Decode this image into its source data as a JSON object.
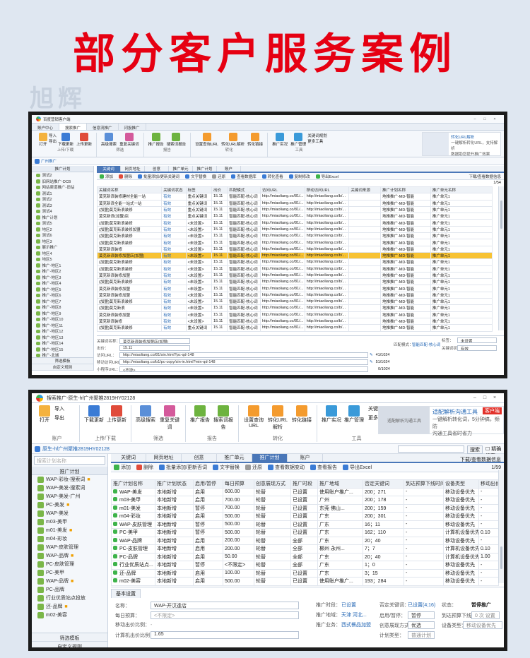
{
  "header": {
    "title": "部分客户服务案例",
    "watermark": "旭辉"
  },
  "w1": {
    "title": "百度营销客户端",
    "menu": [
      "账户中心",
      "搜索推广",
      "信息流推广",
      "闪投推广"
    ],
    "ribbon": {
      "open": "打开",
      "import": "导入",
      "export": "导出",
      "download_updates": "下载更新",
      "upload_updates": "上传更新",
      "upload_group": "上传/下载",
      "advanced_search": "高级搜索",
      "keyword_dedup": "重复关键词",
      "filter_group": "筛选",
      "promo_report": "推广报告",
      "search_report": "搜索词报告",
      "set_queries": "设置查询URL",
      "convert_url": "转化URL解析",
      "convert_link": "转化链接",
      "promo_realtime": "推广实况",
      "promo_manage": "推广管理",
      "keyword_planner": "关键词规划",
      "more_tools": "更多工具",
      "report_group": "报告",
      "convert_group": "转化",
      "tools_group": "工具",
      "ad_title": "转化URL解析",
      "ad_sub1": "一键解析转化URL，支持解析",
      "ad_sub2": "数据助您提升推广效果"
    },
    "account": "广州推广",
    "tabs": [
      "关键词",
      "网页地址",
      "创意",
      "推广单元",
      "推广计划",
      "账户"
    ],
    "toolbar": [
      "添加",
      "删除",
      "批量添加/更新关键词",
      "文字替换",
      "还原",
      "查看数据库",
      "转化查看",
      "复制修改",
      "导出Excel"
    ],
    "toolbar_right": "下载/查看数据信息",
    "page": "1/54",
    "sidebar_head": "推广计划",
    "sidebar_items": [
      "测试2",
      "旧网站推广-DCB",
      "网站渠道推广-旧站",
      "测试1",
      "测试2",
      "测试3",
      "测试4",
      "推广计划",
      "测试5",
      "地区2",
      "测试6",
      "地区3",
      "展示推广",
      "地区4",
      "地区5",
      "推广-地区1",
      "推广-地区2",
      "推广-地区3",
      "推广-地区4",
      "推广-地区5",
      "推广-地区6",
      "推广-地区7",
      "推广-地区8",
      "推广-地区9",
      "推广-地区10",
      "推广-地区11",
      "推广-地区12",
      "推广-地区13",
      "推广-地区14",
      "推广-地区15",
      "推广-北城",
      "推广-北城2"
    ],
    "sidebar_foot": [
      "筛选模板",
      "自定义规则"
    ],
    "columns": [
      "关键词名称",
      "关键词状态",
      "标签",
      "出价",
      "匹配模式",
      "访问URL",
      "移动访问URL",
      "关键词来源",
      "推广计划名称",
      "推广单元名称"
    ],
    "rows": [
      [
        "莫克新浪装修建材全能一站",
        "有效",
        "重点关键词",
        "15.11",
        "智能匹配-核心词",
        "http://miaoliang.co/81/...",
        "http://miaoliang.co/b/...",
        "",
        "地推推广-MD-智能",
        "推广单元1"
      ],
      [
        "莫克新浪全能一站式一站",
        "有效",
        "重点关键词",
        "15.11",
        "智能匹配-核心词",
        "http://miaoliang.co/81/...",
        "http://miaoliang.co/b/...",
        "",
        "地推推广-MD-智能",
        "推广单元1"
      ],
      [
        "(加盟)莫克新浪装修",
        "有效",
        "重点关键词",
        "15.11",
        "智能匹配-核心词",
        "http://miaoliang.co/81/...",
        "http://miaoliang.co/b/...",
        "",
        "地推推广-MD-智能",
        "推广单元1"
      ],
      [
        "莫克新浪(加盟)店",
        "有效",
        "重点关键词",
        "15.11",
        "智能匹配-核心词",
        "http://miaoliang.co/81/...",
        "http://miaoliang.co/b/...",
        "",
        "地推推广-MD-智能",
        "推广单元1"
      ],
      [
        "(加盟)莫克新浪装修",
        "有效",
        "<未设置>",
        "15.11",
        "智能匹配-核心词",
        "http://miaoliang.co/81/...",
        "http://miaoliang.co/b/...",
        "",
        "地推推广-MD-智能",
        "推广单元1"
      ],
      [
        "(加盟)莫克新浪装修加盟",
        "有效",
        "<未设置>",
        "15.11",
        "智能匹配-核心词",
        "http://miaoliang.co/81/...",
        "http://miaoliang.co/b/...",
        "",
        "地推推广-MD-智能",
        "推广单元1"
      ],
      [
        "(加盟)莫克新浪装修",
        "有效",
        "<未设置>",
        "15.11",
        "智能匹配-核心词",
        "http://miaoliang.co/81/...",
        "http://miaoliang.co/b/...",
        "",
        "地推推广-MD-智能",
        "推广单元1"
      ],
      [
        "(加盟)莫克新浪装修",
        "有效",
        "<未设置>",
        "15.11",
        "智能匹配-核心词",
        "http://miaoliang.co/81/...",
        "http://miaoliang.co/b/...",
        "",
        "地推推广-MD-智能",
        "推广单元1"
      ],
      [
        "莫克新浪装修",
        "有效",
        "<未设置>",
        "15.11",
        "智能匹配-核心词",
        "http://miaoliang.co/81/...",
        "http://miaoliang.co/b/...",
        "",
        "地推推广-MD-智能",
        "推广单元1"
      ],
      [
        "莫克新浪装修加盟店(加盟)",
        "有效",
        "<未设置>",
        "15.11",
        "智能匹配-核心词",
        "http://miaoliang.co/81/...",
        "http://miaoliang.co/b/...",
        "",
        "地推推广-MD-智能",
        "推广单元1"
      ],
      [
        "(加盟)莫克新浪装修",
        "有效",
        "<未设置>",
        "15.11",
        "智能匹配-核心词",
        "http://miaoliang.co/81/...",
        "http://miaoliang.co/b/...",
        "",
        "地推推广-MD-智能",
        "推广单元1"
      ],
      [
        "(加盟)莫克新浪装修",
        "有效",
        "<未设置>",
        "15.11",
        "智能匹配-核心词",
        "http://miaoliang.co/81/...",
        "http://miaoliang.co/b/...",
        "",
        "地推推广-MD-智能",
        "推广单元1"
      ],
      [
        "莫克新浪装修加盟",
        "有效",
        "<未设置>",
        "15.11",
        "智能匹配-核心词",
        "http://miaoliang.co/81/...",
        "http://miaoliang.co/b/...",
        "",
        "地推推广-MD-智能",
        "推广单元1"
      ],
      [
        "(加盟)莫克新浪装修",
        "有效",
        "<未设置>",
        "15.11",
        "智能匹配-核心词",
        "http://miaoliang.co/81/...",
        "http://miaoliang.co/b/...",
        "",
        "地推推广-MD-智能",
        "推广单元1"
      ],
      [
        "莫克新浪装修加盟",
        "有效",
        "<未设置>",
        "15.11",
        "智能匹配-核心词",
        "http://miaoliang.co/81/...",
        "http://miaoliang.co/b/...",
        "",
        "地推推广-MD-智能",
        "推广单元1"
      ],
      [
        "莫克新浪装修加盟",
        "有效",
        "<未设置>",
        "15.11",
        "智能匹配-核心词",
        "http://miaoliang.co/81/...",
        "http://miaoliang.co/b/...",
        "",
        "地推推广-MD-智能",
        "推广单元1"
      ],
      [
        "(加盟)莫克新浪装修",
        "有效",
        "<未设置>",
        "15.11",
        "智能匹配-核心词",
        "http://miaoliang.co/81/...",
        "http://miaoliang.co/b/...",
        "",
        "地推推广-MD-智能",
        "推广单元1"
      ],
      [
        "(加盟)莫克新浪",
        "有效",
        "<未设置>",
        "15.11",
        "智能匹配-核心词",
        "http://miaoliang.co/81/...",
        "http://miaoliang.co/b/...",
        "",
        "地推推广-MD-智能",
        "推广单元1"
      ],
      [
        "莫克新浪装修加盟",
        "有效",
        "<未设置>",
        "15.11",
        "智能匹配-核心词",
        "http://miaoliang.co/81/...",
        "http://miaoliang.co/b/...",
        "",
        "地推推广-MD-智能",
        "推广单元1"
      ],
      [
        "莫克新浪装修",
        "有效",
        "<未设置>",
        "15.11",
        "智能匹配-核心词",
        "http://miaoliang.co/81/...",
        "http://miaoliang.co/b/...",
        "",
        "地推推广-MD-智能",
        "推广单元1"
      ],
      [
        "(加盟)莫克新浪装修",
        "有效",
        "重点关键词",
        "15.11",
        "智能匹配-核心词",
        "http://miaoliang.co/81/...",
        "http://miaoliang.co/b/...",
        "",
        "地推推广-MD-智能",
        "推广单元1"
      ]
    ],
    "highlight_row": 9,
    "detail": {
      "kw_label": "关键词名称：",
      "kw_value": "莫克新浪装修加盟店(加盟)",
      "bid_label": "出价：",
      "bid_value": "15.11",
      "url_label": "访问URL：",
      "url_value": "http://miaoliang.co/81/sin.html?pc-qd-148",
      "murl_label": "移动访问URL：",
      "murl_value": "http://miaoliang.co/b1/pc-copy/sin-in.html?min-qd-148",
      "mon_label": "小程序URL：",
      "mon_value": "<不设>",
      "match_label": "匹配模式：",
      "match_value": "智能匹配-核心词",
      "tag_label": "标签：",
      "tag_value": "未设置",
      "status_label": "关键词状态：",
      "status_value": "有效",
      "count1": "41/1024",
      "count2": "51/1024",
      "count3": "0/1024"
    }
  },
  "w2": {
    "title": "搜索推广-原生-hf广州聚推2819HY02128",
    "ribbon": {
      "open": "打开",
      "import": "导入",
      "export": "导出",
      "download_updates": "下载更新",
      "upload_updates": "上传更新",
      "account_group": "账户",
      "upload_group": "上传/下载",
      "advanced_search": "高级搜索",
      "keyword_dedup": "重复关键词",
      "filter_group": "筛选",
      "promo_report": "推广报告",
      "search_report": "搜索词报告",
      "report_group": "报告",
      "set_queries": "设置查询URL",
      "convert_url": "转化URL解析",
      "convert_link": "转化链接",
      "convert_group": "转化",
      "promo_realtime": "推广实况",
      "promo_manage": "推广管理",
      "keyword_planner": "关键词规划",
      "more_tools": "更多工具",
      "tools_group": "工具",
      "ad_box": "适配解析沟通工具",
      "ad_title": "适配解析沟通工具",
      "ad_sub1": "一键解析转化词，5分钟搞，频防",
      "ad_sub2": "沟通工具省时省力",
      "ad_tag": "客户端"
    },
    "account": "原生-hf广州聚推2819HY02128",
    "search_btn": "搜索",
    "exact_search": "精确搜索",
    "tabs": [
      "关键词",
      "网页地址",
      "创意",
      "推广单元",
      "推广计划",
      "账户"
    ],
    "toolbar": [
      "添加",
      "删除",
      "批量添加/更新否词",
      "文字替换",
      "还原",
      "查看数据变动",
      "查看报告",
      "导出Excel"
    ],
    "toolbar_right": "下载/查看数据信息",
    "page": "1/59",
    "sidebar_search": "搜索计划名称",
    "sidebar_head": "推广计划",
    "sidebar_items": [
      "WAP-彩妆-搜索词",
      "WAP-美发-搜索词",
      "WAP-美发-广州",
      "PC-美发",
      "WAP-美发",
      "m03-美甲",
      "m01-美发",
      "m04-彩妆",
      "WAP-皮肤管理",
      "WAP-品牌",
      "PC-皮肤管理",
      "PC-美甲",
      "WAP-品牌",
      "PC-品牌",
      "行业优质站点投放",
      "还-品牌",
      "m02-美容"
    ],
    "sidebar_foot": [
      "筛选模板",
      "自定义规则"
    ],
    "columns": [
      "推广计划名称",
      "推广计划状态",
      "启用/暂停",
      "每日预算",
      "创意展现方式",
      "推广时段",
      "推广地域",
      "否定关键词",
      "到达预算下线时间",
      "设备类型",
      "移动出价"
    ],
    "rows": [
      [
        "WAP-美发",
        "本地新增",
        "启用",
        "600.00",
        "轮替",
        "已设置",
        "使用账户推广...",
        "200；271",
        "-",
        "移动设备优先",
        "-"
      ],
      [
        "m03-美甲",
        "本地新增",
        "启用",
        "700.00",
        "轮替",
        "已设置",
        "广州",
        "200；178",
        "-",
        "移动设备优先",
        "-"
      ],
      [
        "m01-美发",
        "本地新增",
        "暂停",
        "700.00",
        "轮替",
        "已设置",
        "东莞 佛山...",
        "200；159",
        "-",
        "移动设备优先",
        "-"
      ],
      [
        "m04-彩妆",
        "本地新增",
        "启用",
        "500.00",
        "轮替",
        "已设置",
        "广东",
        "200；301",
        "-",
        "移动设备优先",
        "-"
      ],
      [
        "WAP-皮肤管理",
        "本地新增",
        "暂停",
        "500.00",
        "轮替",
        "已设置",
        "广东",
        "16；11",
        "-",
        "移动设备优先",
        "-"
      ],
      [
        "PC-美甲",
        "本地新增",
        "暂停",
        "500.00",
        "轮替",
        "已设置",
        "广东",
        "162；110",
        "-",
        "计算机设备优先",
        "0.10"
      ],
      [
        "WAP-品牌",
        "本地新增",
        "启用",
        "200.00",
        "轮替",
        "全部",
        "广东",
        "20；40",
        "-",
        "移动设备优先",
        "-"
      ],
      [
        "PC-皮肤管理",
        "本地新增",
        "启用",
        "200.00",
        "轮替",
        "全部",
        "郴州 永州...",
        "7；7",
        "-",
        "计算机设备优先",
        "0.10"
      ],
      [
        "PC-品牌",
        "本地新增",
        "启用",
        "50.00",
        "轮替",
        "全部",
        "广东",
        "20；40",
        "-",
        "计算机设备优先",
        "1.00"
      ],
      [
        "行业优质站点...",
        "本地新增",
        "暂停",
        "<不限定>",
        "轮替",
        "全部",
        "广东",
        "1；0",
        "-",
        "移动设备优先",
        "-"
      ],
      [
        "还-品牌",
        "本地新增",
        "启用",
        "100.00",
        "轮替",
        "已设置",
        "广东",
        "3；15",
        "-",
        "移动设备优先",
        "-"
      ],
      [
        "m02-美容",
        "本地新增",
        "启用",
        "500.00",
        "轮替",
        "已设置",
        "使用账户推广...",
        "193；284",
        "-",
        "移动设备优先",
        "-"
      ]
    ],
    "detail": {
      "tab": "基本设置",
      "name_label": "名称：",
      "name_value": "WAP-开汉逢店",
      "budget_label": "每日预算：",
      "budget_value": "<不限定>",
      "ratio_label": "移动出价比例：",
      "ratio_value": "-",
      "pc_ratio_label": "计算机出价比例：",
      "pc_ratio_value": "1.65",
      "time_label": "推广时段：",
      "time_value": "已设置",
      "region_label": "推广地域：",
      "region_value": "天津 河北...",
      "biz_label": "推广业务：",
      "biz_value": "西式餐品加盟",
      "neg_label": "否定关键词：",
      "neg_value": "已设置(4;16)",
      "pause_label": "启用/暂停：",
      "pause_value": "暂停",
      "style_label": "创意展现方式：",
      "style_value": "优选",
      "type_label": "计划类型：",
      "type_value": "普通计划",
      "state_label": "状态：",
      "state_value": "暂停推广",
      "down_label": "到达预算下线：",
      "down_value": "0 次 设置",
      "device_label": "设备类型：",
      "device_value": "移动设备优先"
    }
  }
}
